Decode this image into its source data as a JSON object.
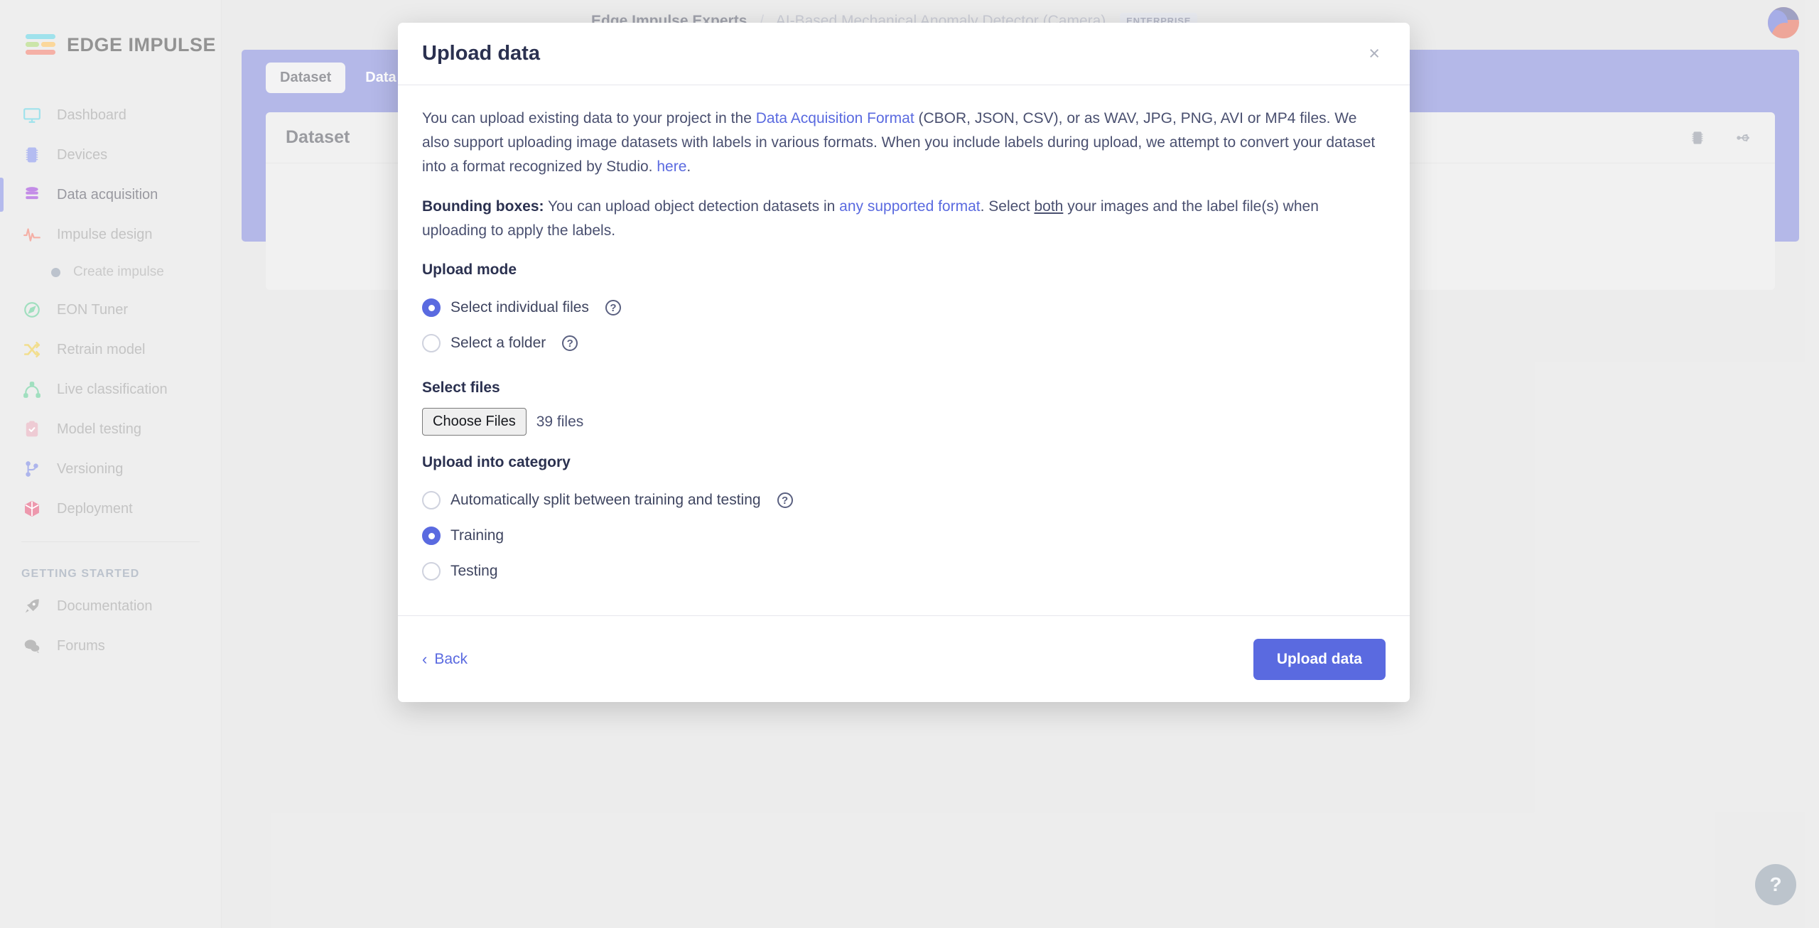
{
  "brand": {
    "name": "EDGE IMPULSE"
  },
  "sidebar": {
    "items": [
      {
        "label": "Dashboard",
        "icon": "monitor-icon",
        "active": false
      },
      {
        "label": "Devices",
        "icon": "chip-icon",
        "active": false
      },
      {
        "label": "Data acquisition",
        "icon": "database-icon",
        "active": true
      },
      {
        "label": "Impulse design",
        "icon": "pulse-icon",
        "active": false
      }
    ],
    "sub_item": {
      "label": "Create impulse",
      "icon": "dot-icon"
    },
    "items2": [
      {
        "label": "EON Tuner",
        "icon": "compass-icon"
      },
      {
        "label": "Retrain model",
        "icon": "shuffle-icon"
      },
      {
        "label": "Live classification",
        "icon": "nodes-icon"
      },
      {
        "label": "Model testing",
        "icon": "clipboard-check-icon"
      },
      {
        "label": "Versioning",
        "icon": "git-branch-icon"
      },
      {
        "label": "Deployment",
        "icon": "cube-icon"
      }
    ],
    "heading": "GETTING STARTED",
    "items3": [
      {
        "label": "Documentation",
        "icon": "rocket-icon"
      },
      {
        "label": "Forums",
        "icon": "chat-icon"
      }
    ]
  },
  "topbar": {
    "breadcrumb_owner": "Edge Impulse Experts",
    "breadcrumb_sep": "/",
    "breadcrumb_project": "AI-Based Mechanical Anomaly Detector (Camera)",
    "enterprise_badge": "ENTERPRISE"
  },
  "page": {
    "tabs": [
      {
        "label": "Dataset",
        "active": true
      },
      {
        "label": "Data sources",
        "active": false
      }
    ],
    "card_title": "Dataset",
    "card_actions": [
      {
        "icon": "chip-icon"
      },
      {
        "icon": "usb-icon"
      }
    ]
  },
  "help": {
    "label": "?"
  },
  "modal": {
    "title": "Upload data",
    "close_label": "×",
    "intro": {
      "p1_a": "You can upload existing data to your project in the ",
      "p1_link1": "Data Acquisition Format",
      "p1_b": " (CBOR, JSON, CSV), or as WAV, JPG, PNG, AVI or MP4 files. We also support uploading image datasets with labels in various formats. When you include labels during upload, we attempt to convert your dataset into a format recognized by Studio. ",
      "p1_link2": "here",
      "p1_c": ".",
      "p2_bold": "Bounding boxes:",
      "p2_a": " You can upload object detection datasets in ",
      "p2_link": "any supported format",
      "p2_b": ". Select ",
      "p2_u": "both",
      "p2_c": " your images and the label file(s) when uploading to apply the labels."
    },
    "upload_mode": {
      "label": "Upload mode",
      "options": [
        {
          "label": "Select individual files",
          "checked": true,
          "help": "?"
        },
        {
          "label": "Select a folder",
          "checked": false,
          "help": "?"
        }
      ]
    },
    "select_files": {
      "label": "Select files",
      "button_label": "Choose Files",
      "count_text": "39 files"
    },
    "category": {
      "label": "Upload into category",
      "options": [
        {
          "label": "Automatically split between training and testing",
          "checked": false,
          "help": "?"
        },
        {
          "label": "Training",
          "checked": true,
          "help": ""
        },
        {
          "label": "Testing",
          "checked": false,
          "help": ""
        }
      ]
    },
    "footer": {
      "back_label": "Back",
      "back_chevron": "‹",
      "submit_label": "Upload data"
    }
  },
  "colors": {
    "accent": "#5a6ae0",
    "band": "#5a62cc",
    "sidebar_bg": "#d9d9d9",
    "page_bg": "#d6d6d6"
  }
}
